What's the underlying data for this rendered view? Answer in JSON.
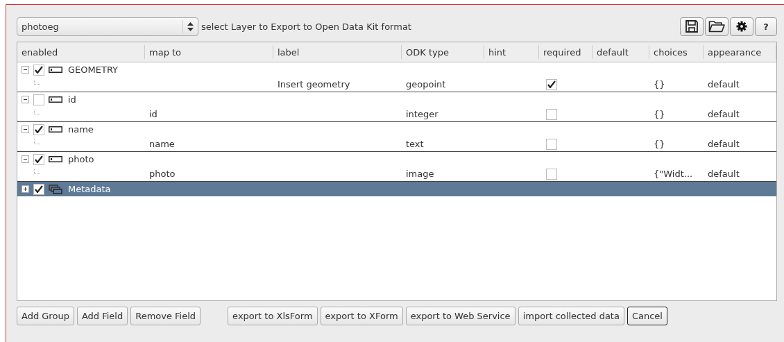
{
  "layer_select": {
    "value": "photoeg"
  },
  "instruction": "select Layer to Export to Open Data Kit format",
  "toolbar": {
    "help_label": "?"
  },
  "table": {
    "columns": [
      "enabled",
      "map to",
      "label",
      "ODK type",
      "hint",
      "required",
      "default",
      "choices",
      "appearance"
    ],
    "nodes": [
      {
        "kind": "field",
        "name": "GEOMETRY",
        "enabled": true,
        "expanded": true,
        "selected": false,
        "children": [
          {
            "label": "Insert geometry",
            "odk_type": "geopoint",
            "required": true,
            "choices": "{}",
            "appearance": "default"
          }
        ]
      },
      {
        "kind": "field",
        "name": "id",
        "enabled": false,
        "expanded": true,
        "selected": false,
        "children": [
          {
            "map_to": "id",
            "odk_type": "integer",
            "required": false,
            "choices": "{}",
            "appearance": "default"
          }
        ]
      },
      {
        "kind": "field",
        "name": "name",
        "enabled": true,
        "expanded": true,
        "selected": false,
        "children": [
          {
            "map_to": "name",
            "odk_type": "text",
            "required": false,
            "choices": "{}",
            "appearance": "default"
          }
        ]
      },
      {
        "kind": "field",
        "name": "photo",
        "enabled": true,
        "expanded": true,
        "selected": false,
        "children": [
          {
            "map_to": "photo",
            "odk_type": "image",
            "required": false,
            "choices": "{\"Widt...",
            "appearance": "default"
          }
        ]
      },
      {
        "kind": "group",
        "name": "Metadata",
        "enabled": true,
        "expanded": false,
        "selected": true
      }
    ]
  },
  "buttons_left": [
    {
      "label": "Add Group",
      "default": false
    },
    {
      "label": "Add Field",
      "default": false
    },
    {
      "label": "Remove Field",
      "default": false
    }
  ],
  "buttons_right": [
    {
      "label": "export to XlsForm",
      "default": false
    },
    {
      "label": "export to XForm",
      "default": false
    },
    {
      "label": "export to Web Service",
      "default": false
    },
    {
      "label": "import collected data",
      "default": false
    },
    {
      "label": "Cancel",
      "default": true
    }
  ]
}
